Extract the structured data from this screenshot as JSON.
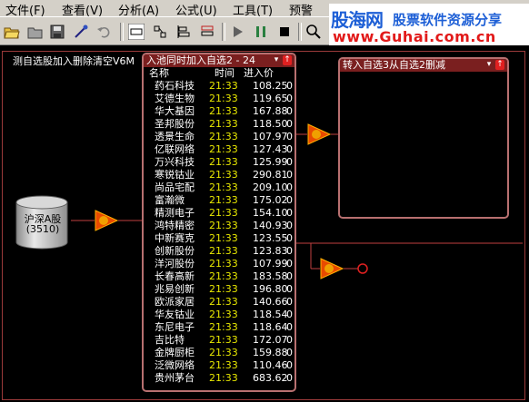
{
  "menu": [
    {
      "label": "文件(F)"
    },
    {
      "label": "查看(V)"
    },
    {
      "label": "分析(A)"
    },
    {
      "label": "公式(U)"
    },
    {
      "label": "工具(T)"
    },
    {
      "label": "预警"
    }
  ],
  "brand": {
    "title": "股海网",
    "subtitle": "股票软件资源分享",
    "url": "www.Guhai.com.cn"
  },
  "canvas_title": "测自选股加入删除清空V6M",
  "source": {
    "label": "沪深A股",
    "count": "(3510)"
  },
  "pool1": {
    "title": "入池同时加入自选2 - 24",
    "headers": {
      "name": "名称",
      "time": "时间",
      "price": "进入价"
    },
    "rows": [
      {
        "name": "药石科技",
        "time": "21:33",
        "price": "108.25",
        "zero": "0"
      },
      {
        "name": "艾德生物",
        "time": "21:33",
        "price": "119.65",
        "zero": "0"
      },
      {
        "name": "华大基因",
        "time": "21:33",
        "price": "167.88",
        "zero": "0"
      },
      {
        "name": "圣邦股份",
        "time": "21:33",
        "price": "118.50",
        "zero": "0"
      },
      {
        "name": "透景生命",
        "time": "21:33",
        "price": "107.97",
        "zero": "0"
      },
      {
        "name": "亿联网络",
        "time": "21:33",
        "price": "127.43",
        "zero": "0"
      },
      {
        "name": "万兴科技",
        "time": "21:33",
        "price": "125.99",
        "zero": "0"
      },
      {
        "name": "寒锐钴业",
        "time": "21:33",
        "price": "290.81",
        "zero": "0"
      },
      {
        "name": "尚品宅配",
        "time": "21:33",
        "price": "209.10",
        "zero": "0"
      },
      {
        "name": "富瀚微",
        "time": "21:33",
        "price": "175.02",
        "zero": "0"
      },
      {
        "name": "精测电子",
        "time": "21:33",
        "price": "154.10",
        "zero": "0"
      },
      {
        "name": "鸿特精密",
        "time": "21:33",
        "price": "140.93",
        "zero": "0"
      },
      {
        "name": "中新赛克",
        "time": "21:33",
        "price": "123.55",
        "zero": "0"
      },
      {
        "name": "创新股份",
        "time": "21:33",
        "price": "123.83",
        "zero": "0"
      },
      {
        "name": "洋河股份",
        "time": "21:33",
        "price": "107.99",
        "zero": "0"
      },
      {
        "name": "长春高新",
        "time": "21:33",
        "price": "183.58",
        "zero": "0"
      },
      {
        "name": "兆易创新",
        "time": "21:33",
        "price": "196.80",
        "zero": "0"
      },
      {
        "name": "欧派家居",
        "time": "21:33",
        "price": "140.66",
        "zero": "0"
      },
      {
        "name": "华友钴业",
        "time": "21:33",
        "price": "118.54",
        "zero": "0"
      },
      {
        "name": "东尼电子",
        "time": "21:33",
        "price": "118.64",
        "zero": "0"
      },
      {
        "name": "吉比特",
        "time": "21:33",
        "price": "172.07",
        "zero": "0"
      },
      {
        "name": "金牌厨柜",
        "time": "21:33",
        "price": "159.88",
        "zero": "0"
      },
      {
        "name": "泛微网络",
        "time": "21:33",
        "price": "110.46",
        "zero": "0"
      },
      {
        "name": "贵州茅台",
        "time": "21:33",
        "price": "683.62",
        "zero": "0"
      }
    ]
  },
  "pool2": {
    "title": "转入自选3从自选2删减"
  },
  "colors": {
    "panel_title_bg": "#7a1f1f",
    "panel_border": "#b87070",
    "time_text": "#e8e800",
    "filter_fill": "#e84a00",
    "filter_inner": "#f0a000",
    "connector": "#c04040"
  },
  "icons": [
    "open-folder-icon",
    "folder-icon",
    "save-icon",
    "wand-icon",
    "undo-icon",
    "rectangle-tool-icon",
    "layout-tool-icon",
    "align-tool-icon",
    "list-tool-icon",
    "play-icon",
    "pause-icon",
    "stop-icon",
    "search-icon"
  ]
}
